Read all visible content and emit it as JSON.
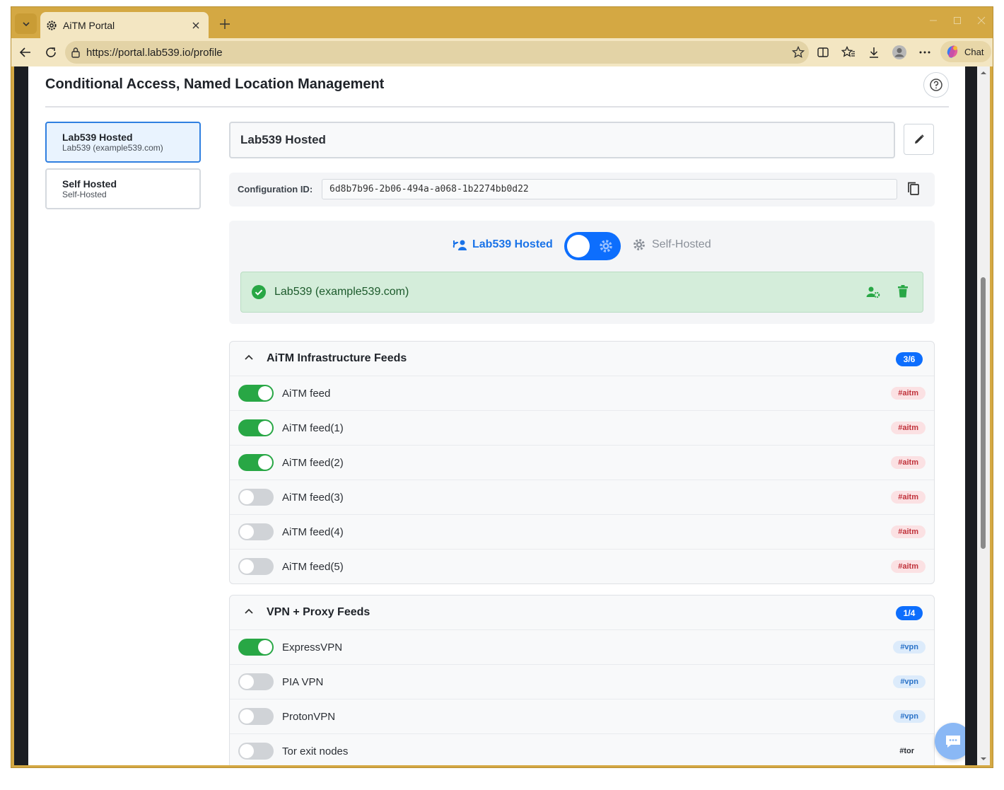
{
  "browser": {
    "tab_title": "AiTM Portal",
    "url": "https://portal.lab539.io/profile",
    "chat_label": "Chat"
  },
  "page": {
    "title": "Conditional Access, Named Location Management"
  },
  "configs": [
    {
      "name": "Lab539 Hosted",
      "sub": "Lab539 (example539.com)",
      "active": true
    },
    {
      "name": "Self Hosted",
      "sub": "Self-Hosted",
      "active": false
    }
  ],
  "detail": {
    "name": "Lab539 Hosted",
    "config_id_label": "Configuration ID:",
    "config_id": "6d8b7b96-2b06-494a-a068-1b2274bb0d22",
    "mode_left_label": "Lab539 Hosted",
    "mode_right_label": "Self-Hosted",
    "tenant": "Lab539 (example539.com)"
  },
  "sections": [
    {
      "title": "AiTM Infrastructure Feeds",
      "count": "3/6",
      "feeds": [
        {
          "name": "AiTM feed",
          "on": true,
          "tag": "#aitm",
          "tag_type": "aitm"
        },
        {
          "name": "AiTM feed(1)",
          "on": true,
          "tag": "#aitm",
          "tag_type": "aitm"
        },
        {
          "name": "AiTM feed(2)",
          "on": true,
          "tag": "#aitm",
          "tag_type": "aitm"
        },
        {
          "name": "AiTM feed(3)",
          "on": false,
          "tag": "#aitm",
          "tag_type": "aitm"
        },
        {
          "name": "AiTM feed(4)",
          "on": false,
          "tag": "#aitm",
          "tag_type": "aitm"
        },
        {
          "name": "AiTM feed(5)",
          "on": false,
          "tag": "#aitm",
          "tag_type": "aitm"
        }
      ]
    },
    {
      "title": "VPN + Proxy Feeds",
      "count": "1/4",
      "feeds": [
        {
          "name": "ExpressVPN",
          "on": true,
          "tag": "#vpn",
          "tag_type": "vpn"
        },
        {
          "name": "PIA VPN",
          "on": false,
          "tag": "#vpn",
          "tag_type": "vpn"
        },
        {
          "name": "ProtonVPN",
          "on": false,
          "tag": "#vpn",
          "tag_type": "vpn"
        },
        {
          "name": "Tor exit nodes",
          "on": false,
          "tag": "#tor",
          "tag_type": "tor"
        }
      ]
    }
  ],
  "colors": {
    "accent": "#0d6efd",
    "toggle_on": "#28a745",
    "success_bg": "#d4edda",
    "browser_frame": "#d4a843"
  }
}
